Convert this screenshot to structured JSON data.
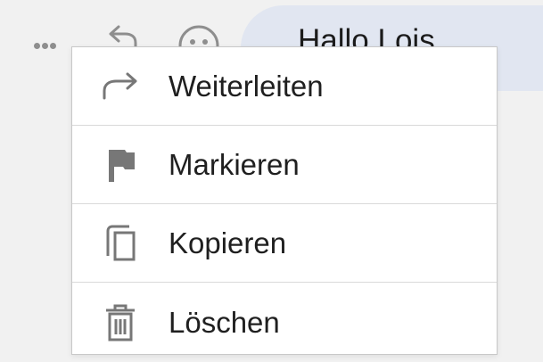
{
  "message": {
    "text": "Hallo Lois"
  },
  "toolbar": {
    "icons": [
      "more-options-icon",
      "reply-icon",
      "emoji-icon"
    ]
  },
  "context_menu": {
    "items": [
      {
        "label": "Weiterleiten",
        "icon": "forward-arrow-icon"
      },
      {
        "label": "Markieren",
        "icon": "flag-icon"
      },
      {
        "label": "Kopieren",
        "icon": "copy-icon"
      },
      {
        "label": "Löschen",
        "icon": "trash-icon"
      }
    ]
  },
  "colors": {
    "background": "#f1f1f1",
    "bubble": "#e1e6f1",
    "menu_background": "#ffffff",
    "icon": "#8e8e8e",
    "text": "#1f1f1f"
  }
}
